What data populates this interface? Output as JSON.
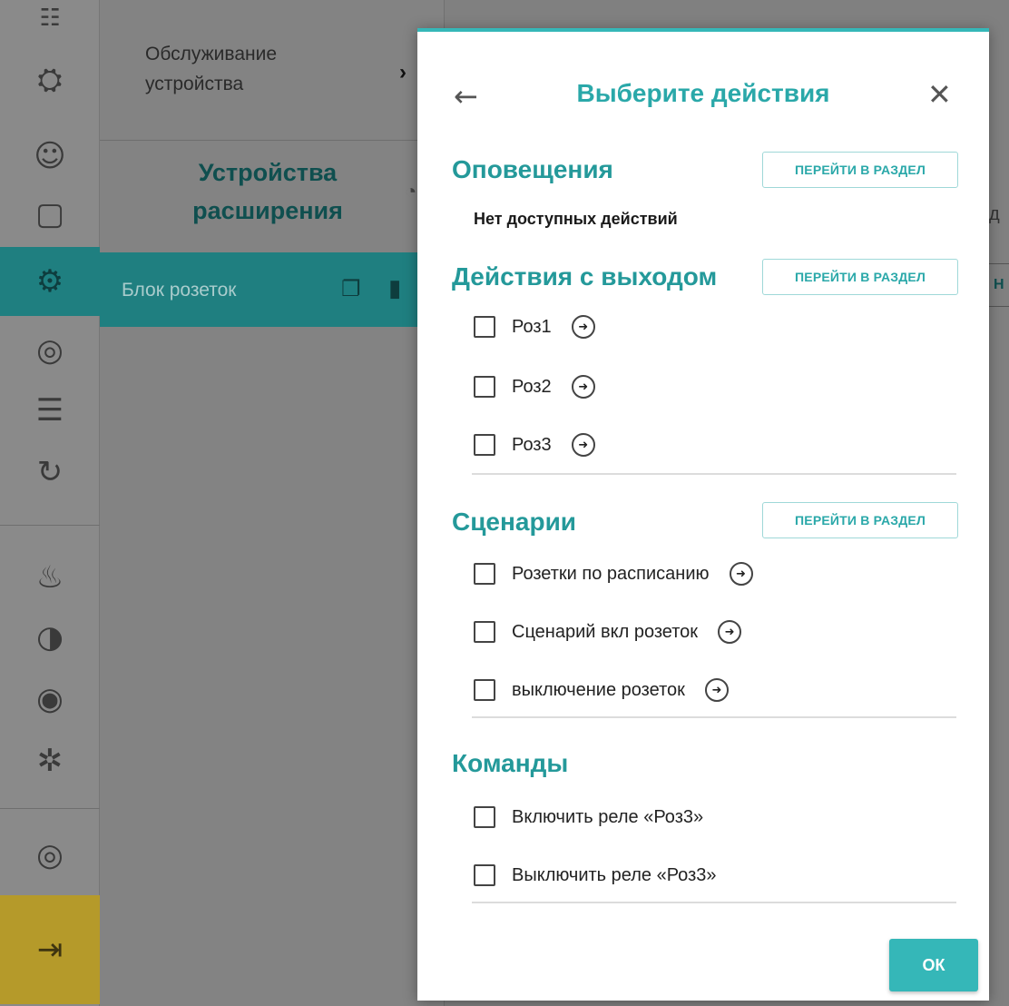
{
  "rail": {
    "items": [
      {
        "icon": "gamepad-icon",
        "glyph": "☷"
      },
      {
        "icon": "users-group-icon",
        "glyph": "⛭"
      },
      {
        "icon": "users-icon",
        "glyph": "☺"
      },
      {
        "icon": "alert-message-icon",
        "glyph": "▢"
      },
      {
        "icon": "devices-icon",
        "glyph": "⚙",
        "active": true
      },
      {
        "icon": "settings-person-icon",
        "glyph": "◎"
      },
      {
        "icon": "list-icon",
        "glyph": "☰"
      },
      {
        "icon": "history-settings-icon",
        "glyph": "↻"
      },
      {
        "icon": "radiator-icon",
        "glyph": "♨"
      },
      {
        "icon": "globe-icon",
        "glyph": "◑"
      },
      {
        "icon": "thermometer-icon",
        "glyph": "◉"
      },
      {
        "icon": "sensor-network-icon",
        "glyph": "✲"
      },
      {
        "icon": "wireless-icon",
        "glyph": "◎"
      },
      {
        "icon": "exit-icon",
        "glyph": "⇥"
      }
    ]
  },
  "panel": {
    "top_label": "Обслуживание устройства",
    "chevron": "›",
    "heading": "Устройства расширения",
    "device": {
      "name": "Блок розеток"
    }
  },
  "background": {
    "right_fragment_1": "д",
    "right_fragment_2": "Н"
  },
  "modal": {
    "back_glyph": "←",
    "title": "Выберите действия",
    "close_glyph": "✕",
    "go_glyph": "➜",
    "section_link": "ПЕРЕЙТИ В РАЗДЕЛ",
    "notifications": {
      "title": "Оповещения",
      "empty": "Нет доступных действий"
    },
    "output_actions": {
      "title": "Действия с выходом",
      "items": [
        {
          "label": "Роз1"
        },
        {
          "label": "Роз2"
        },
        {
          "label": "Роз3"
        }
      ]
    },
    "scenarios": {
      "title": "Сценарии",
      "items": [
        {
          "label": "Розетки по расписанию"
        },
        {
          "label": "Сценарий вкл розеток"
        },
        {
          "label": "выключение розеток"
        }
      ]
    },
    "commands": {
      "title": "Команды",
      "items": [
        {
          "label": "Включить реле «Роз3»"
        },
        {
          "label": "Выключить реле «Роз3»"
        }
      ]
    },
    "ok_label": "ОК"
  },
  "colors": {
    "accent": "#35b7b8",
    "accent_dark": "#24999a",
    "overlay": "#7d7d7d"
  }
}
